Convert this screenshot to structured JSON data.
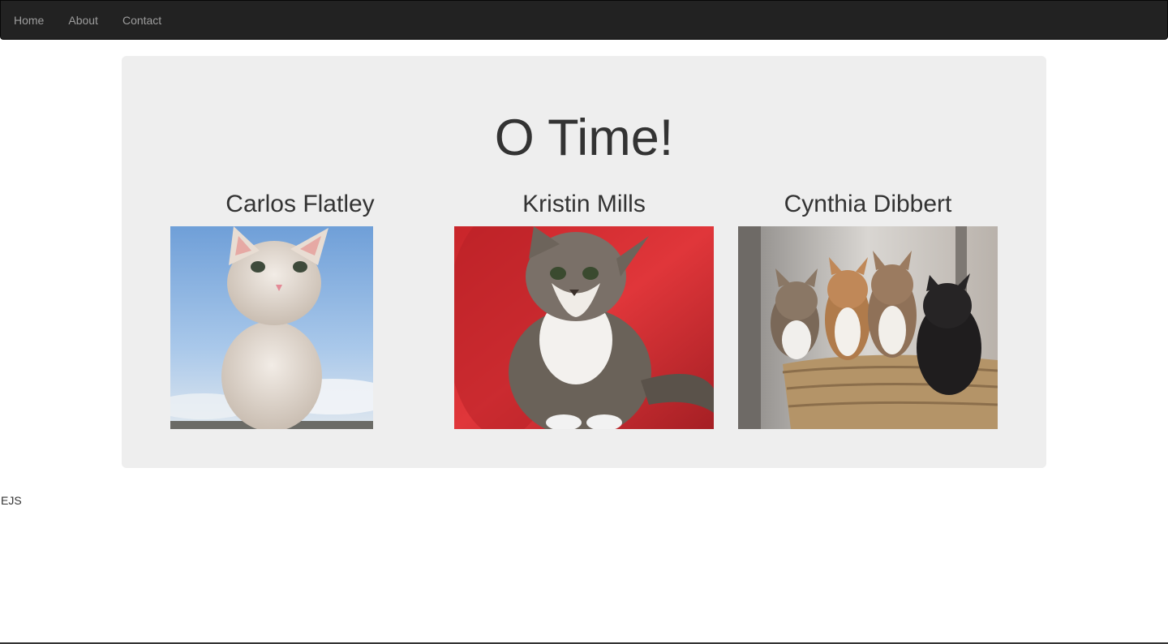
{
  "nav": {
    "items": [
      {
        "label": "Home"
      },
      {
        "label": "About"
      },
      {
        "label": "Contact"
      }
    ]
  },
  "main": {
    "title": "O Time!",
    "people": [
      {
        "name": "Carlos Flatley",
        "photo": "white-kitten-photo"
      },
      {
        "name": "Kristin Mills",
        "photo": "tabby-kitten-photo"
      },
      {
        "name": "Cynthia Dibbert",
        "photo": "kittens-in-basket-photo"
      }
    ]
  },
  "footer": {
    "text": "EJS"
  },
  "colors": {
    "navbar_bg": "#222222",
    "nav_text": "#9d9d9d",
    "jumbotron_bg": "#eeeeee",
    "text": "#333333"
  }
}
